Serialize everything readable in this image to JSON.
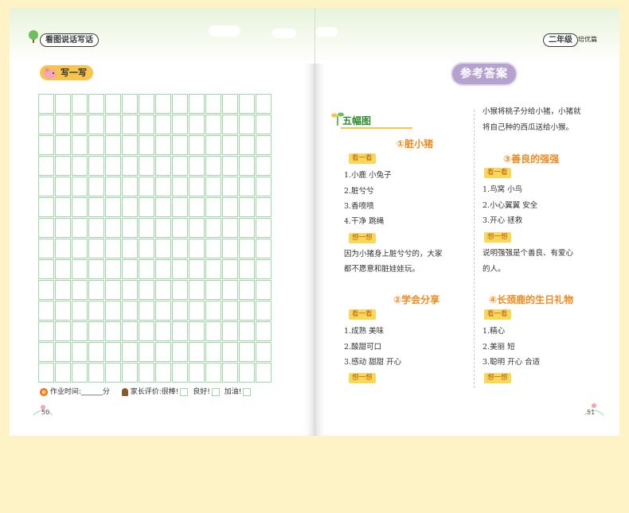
{
  "left_page": {
    "book_title": "看图说话写话",
    "section_label": "写一写",
    "grid": {
      "rows": 14,
      "cols": 14
    },
    "footer": {
      "homework_time_label": "作业时间:",
      "homework_time_blank": "______",
      "time_unit": "分",
      "parent_eval_label": "家长评价:",
      "opt1": "很棒!",
      "opt2": "良好!",
      "opt3": "加油!"
    },
    "page_number": "50"
  },
  "right_page": {
    "grade_label": "二年级",
    "grade_suffix": "培优篇",
    "answer_title": "参考答案",
    "section_heading": "五幅图",
    "left_column": {
      "q1_title": "①脏小猪",
      "q1_look_tag": "看一看",
      "q1_look": [
        "1.小鹿  小兔子",
        "2.脏兮兮",
        "3.香喷喷",
        "4.干净  跳绳"
      ],
      "q1_think_tag": "想一想",
      "q1_think": [
        "因为小猪身上脏兮兮的，大家",
        "都不愿意和脏娃娃玩。"
      ],
      "q2_title": "②学会分享",
      "q2_look_tag": "看一看",
      "q2_look": [
        "1.成熟  美味",
        "2.酸甜可口",
        "3.感动  甜甜  开心"
      ],
      "q2_think_tag": "想一想"
    },
    "right_column": {
      "intro": [
        "小猴将桃子分给小猪，小猪就",
        "将自己种的西瓜送给小猴。"
      ],
      "q3_title": "③善良的强强",
      "q3_look_tag": "看一看",
      "q3_look": [
        "1.鸟窝  小鸟",
        "2.小心翼翼  安全",
        "3.开心  拯救"
      ],
      "q3_think_tag": "想一想",
      "q3_think": [
        "说明强强是个善良、有爱心",
        "的人。"
      ],
      "q4_title": "④长颈鹿的生日礼物",
      "q4_look_tag": "看一看",
      "q4_look": [
        "1.精心",
        "2.美丽  短",
        "3.聪明  开心  合适"
      ],
      "q4_think_tag": "想一想"
    },
    "page_number": "51"
  },
  "colors": {
    "background": "#fdf3c6",
    "grid_green": "#9fd7a6",
    "accent_orange": "#f08a1e",
    "tag_yellow": "#f7d85a",
    "answer_title_purple": "#b5a2cf"
  }
}
